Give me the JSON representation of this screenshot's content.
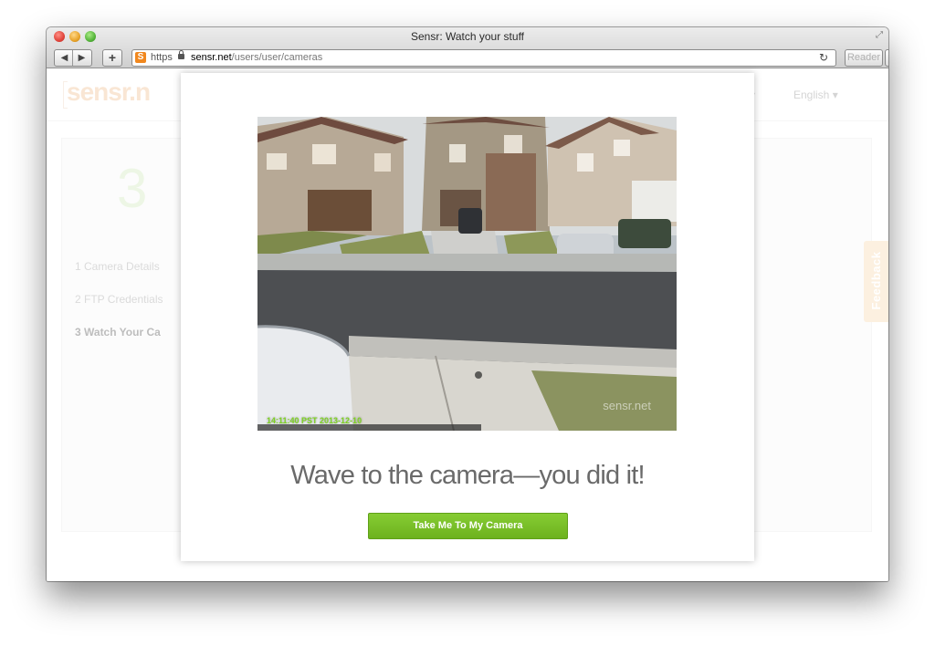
{
  "browser": {
    "window_title": "Sensr: Watch your stuff",
    "url_scheme": "https",
    "url_host": "sensr.net",
    "url_path": "/users/user/cameras",
    "reader_label": "Reader",
    "favicon_letter": "S"
  },
  "page": {
    "logo": "sensr.n",
    "header_caret": "▾",
    "language": "English ▾",
    "step_number": "3",
    "steps": [
      {
        "label": "1  Camera Details"
      },
      {
        "label": "2  FTP Credentials"
      },
      {
        "label": "3  Watch Your Ca"
      }
    ],
    "feedback": "Feedback"
  },
  "modal": {
    "timestamp": "14:11:40 PST 2013-12-10",
    "watermark": "sensr.net",
    "title": "Wave to the camera—you did it!",
    "button": "Take Me To My Camera"
  }
}
